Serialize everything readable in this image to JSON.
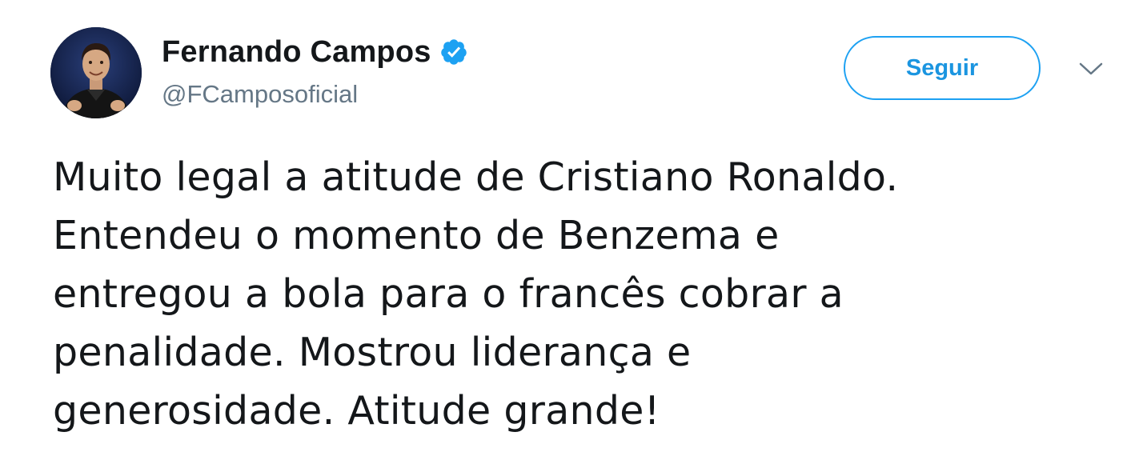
{
  "tweet": {
    "author": {
      "display_name": "Fernando Campos",
      "handle": "@FCamposoficial",
      "verified": true
    },
    "follow_button": {
      "label": "Seguir"
    },
    "text": "Muito legal a atitude de Cristiano Ronaldo.\nEntendeu o momento de Benzema e\nentregou a bola para o francês cobrar a\npenalidade. Mostrou liderança e\ngenerosidade. Atitude grande!"
  },
  "icons": {
    "verified": "verified-badge-icon",
    "menu": "chevron-down-icon"
  },
  "colors": {
    "accent": "#1da1f2",
    "name": "#14171a",
    "handle": "#657786"
  }
}
